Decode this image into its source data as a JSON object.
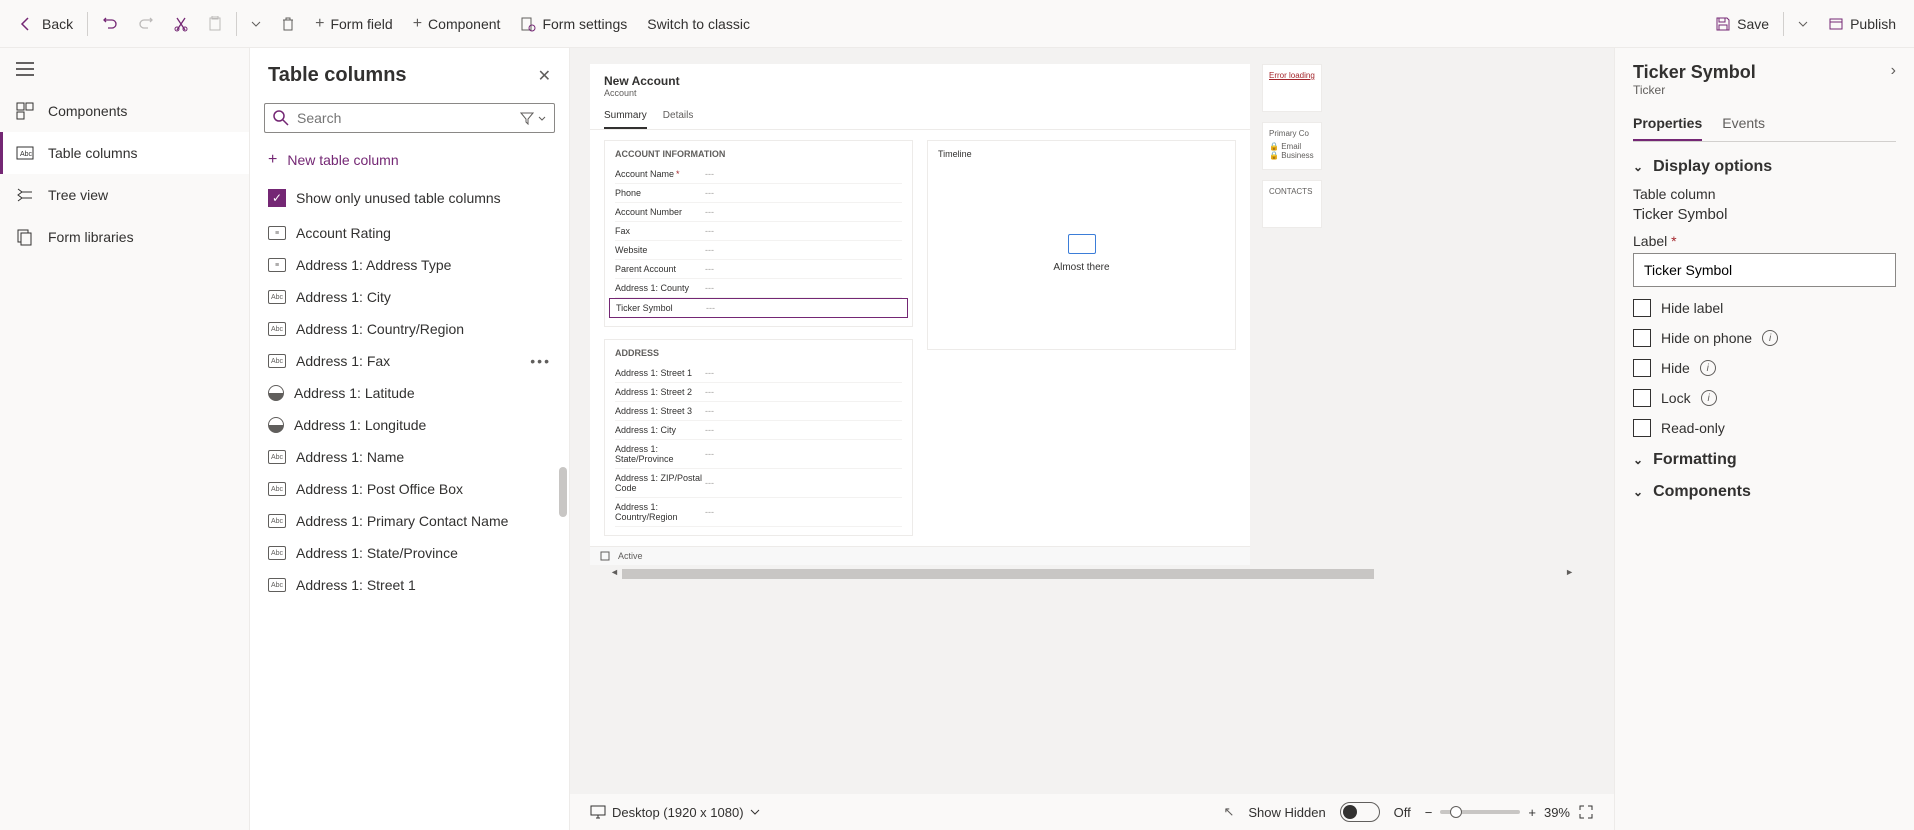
{
  "toolbar": {
    "back": "Back",
    "form_field": "Form field",
    "component": "Component",
    "form_settings": "Form settings",
    "switch_classic": "Switch to classic",
    "save": "Save",
    "publish": "Publish"
  },
  "left_nav": {
    "components": "Components",
    "table_columns": "Table columns",
    "tree_view": "Tree view",
    "form_libraries": "Form libraries"
  },
  "columns_panel": {
    "title": "Table columns",
    "search_placeholder": "Search",
    "new_column": "New table column",
    "show_unused": "Show only unused table columns",
    "items": [
      {
        "label": "Account Rating",
        "icon": "opt"
      },
      {
        "label": "Address 1: Address Type",
        "icon": "opt"
      },
      {
        "label": "Address 1: City",
        "icon": "abc"
      },
      {
        "label": "Address 1: Country/Region",
        "icon": "abc"
      },
      {
        "label": "Address 1: Fax",
        "icon": "abc",
        "more": true
      },
      {
        "label": "Address 1: Latitude",
        "icon": "globe"
      },
      {
        "label": "Address 1: Longitude",
        "icon": "globe"
      },
      {
        "label": "Address 1: Name",
        "icon": "abc"
      },
      {
        "label": "Address 1: Post Office Box",
        "icon": "abc"
      },
      {
        "label": "Address 1: Primary Contact Name",
        "icon": "abc"
      },
      {
        "label": "Address 1: State/Province",
        "icon": "abc"
      },
      {
        "label": "Address 1: Street 1",
        "icon": "abc"
      }
    ]
  },
  "canvas": {
    "form_title": "New Account",
    "form_entity": "Account",
    "tabs": [
      "Summary",
      "Details"
    ],
    "sections": {
      "account_info": {
        "title": "ACCOUNT INFORMATION",
        "fields": [
          {
            "label": "Account Name",
            "req": true,
            "val": "---"
          },
          {
            "label": "Phone",
            "val": "---"
          },
          {
            "label": "Account Number",
            "val": "---"
          },
          {
            "label": "Fax",
            "val": "---"
          },
          {
            "label": "Website",
            "val": "---"
          },
          {
            "label": "Parent Account",
            "val": "---"
          },
          {
            "label": "Address 1: County",
            "val": "---"
          },
          {
            "label": "Ticker Symbol",
            "val": "---",
            "selected": true
          }
        ]
      },
      "address": {
        "title": "ADDRESS",
        "fields": [
          {
            "label": "Address 1: Street 1",
            "val": "---"
          },
          {
            "label": "Address 1: Street 2",
            "val": "---"
          },
          {
            "label": "Address 1: Street 3",
            "val": "---"
          },
          {
            "label": "Address 1: City",
            "val": "---"
          },
          {
            "label": "Address 1: State/Province",
            "val": "---"
          },
          {
            "label": "Address 1: ZIP/Postal Code",
            "val": "---"
          },
          {
            "label": "Address 1: Country/Region",
            "val": "---"
          }
        ]
      },
      "timeline": {
        "title": "Timeline",
        "status": "Almost there"
      }
    },
    "side_cards": {
      "error": "Error loading",
      "primary": "Primary Co",
      "email": "Email",
      "business": "Business",
      "contacts": "CONTACTS"
    },
    "footer_status": "Active"
  },
  "status_bar": {
    "device": "Desktop (1920 x 1080)",
    "show_hidden": "Show Hidden",
    "toggle_state": "Off",
    "zoom_pct": "39%"
  },
  "props": {
    "title": "Ticker Symbol",
    "subtitle": "Ticker",
    "tabs": [
      "Properties",
      "Events"
    ],
    "display_options": "Display options",
    "table_column_label": "Table column",
    "table_column_value": "Ticker Symbol",
    "label_label": "Label",
    "label_value": "Ticker Symbol",
    "hide_label": "Hide label",
    "hide_on_phone": "Hide on phone",
    "hide": "Hide",
    "lock": "Lock",
    "read_only": "Read-only",
    "formatting": "Formatting",
    "components": "Components"
  }
}
